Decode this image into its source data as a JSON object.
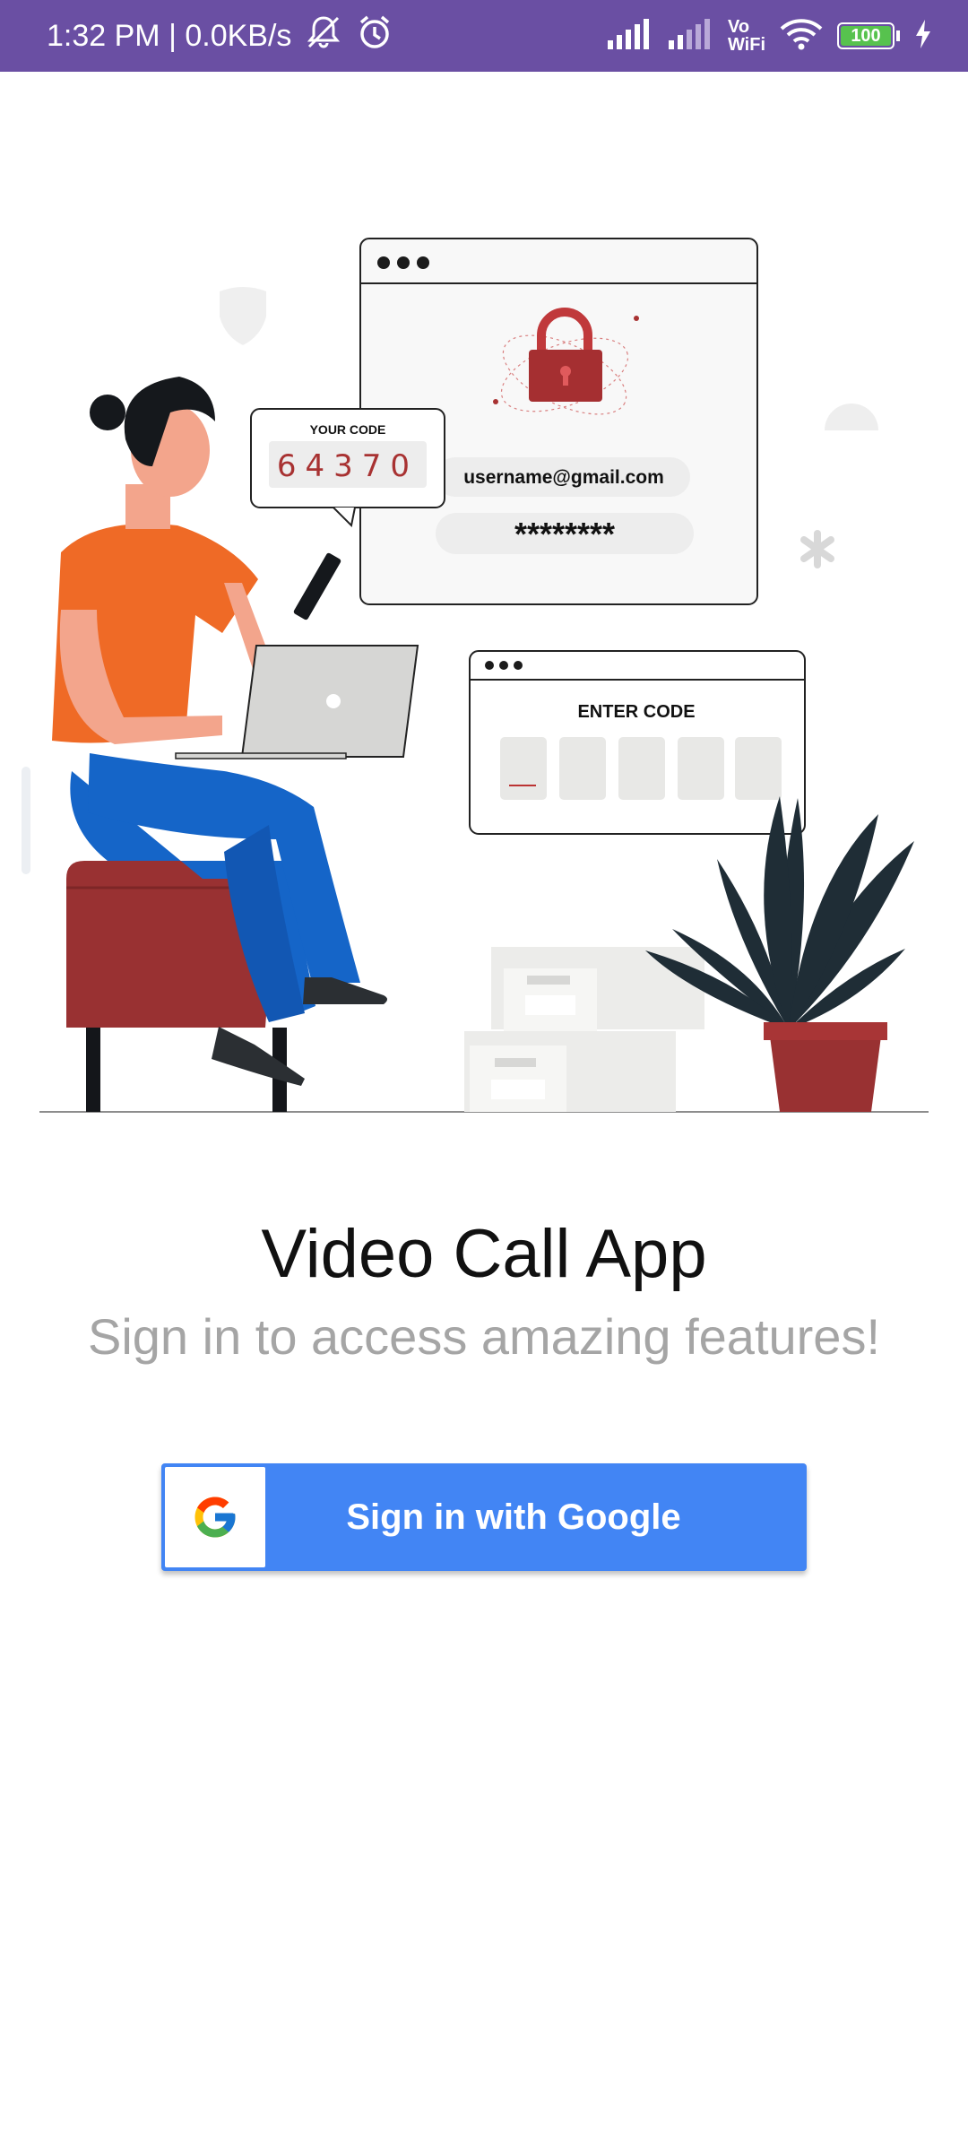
{
  "status_bar": {
    "time": "1:32 PM | 0.0KB/s",
    "vowifi_top": "Vo",
    "vowifi_bottom": "WiFi",
    "battery": "100"
  },
  "illustration": {
    "your_code_label": "YOUR CODE",
    "your_code_value": "64370",
    "email_field": "username@gmail.com",
    "password_field": "********",
    "enter_code_label": "ENTER CODE"
  },
  "main": {
    "title": "Video Call App",
    "subtitle": "Sign in to access amazing features!",
    "google_button_label": "Sign in with Google"
  },
  "colors": {
    "status_bar": "#6a4fa3",
    "google_blue": "#4285f4"
  }
}
